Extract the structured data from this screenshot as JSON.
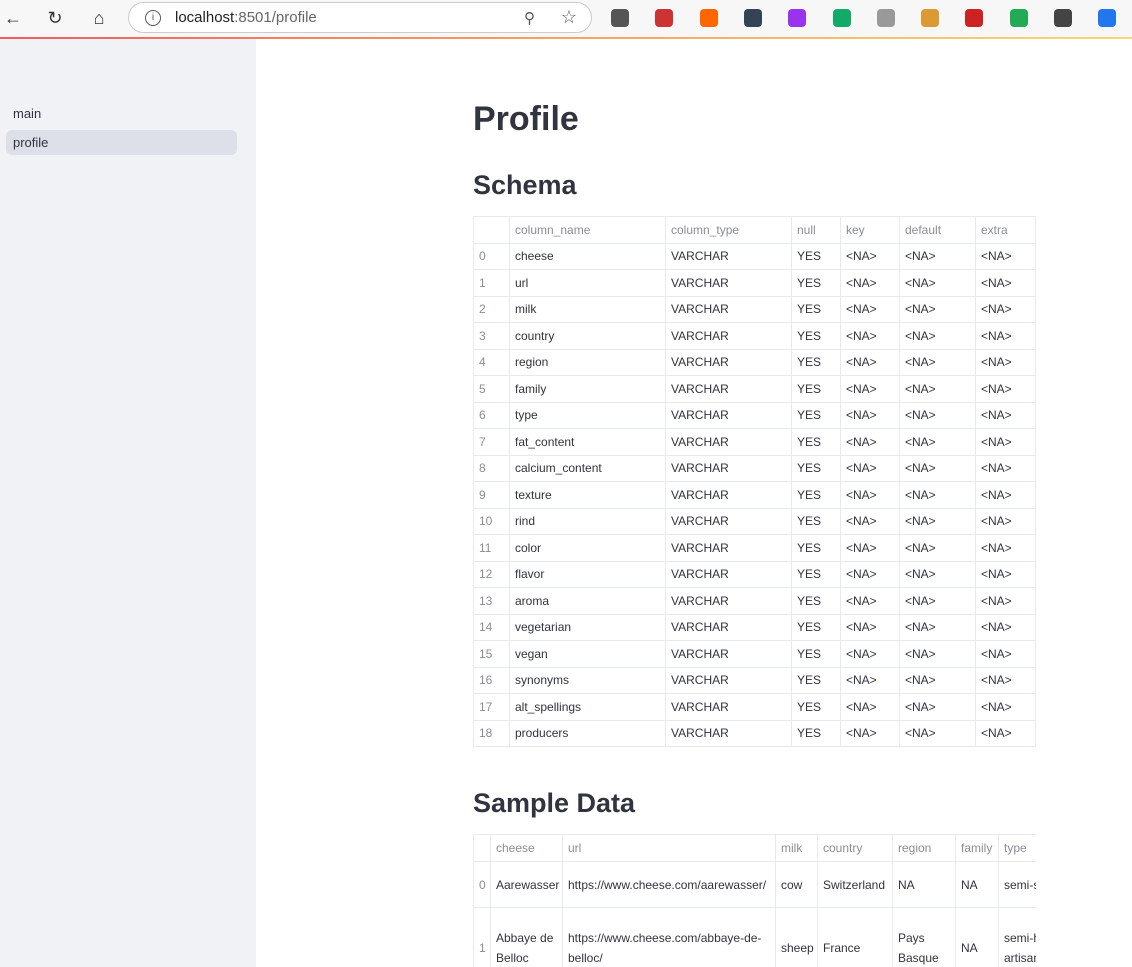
{
  "browser": {
    "url_host": "localhost",
    "url_rest": ":8501/profile",
    "extensions": [
      "#555",
      "#c33",
      "#f60",
      "#345",
      "#93e",
      "#1a6",
      "#999",
      "#d93",
      "#c22",
      "#2a5",
      "#444",
      "#27e"
    ]
  },
  "sidebar": {
    "items": [
      {
        "label": "main"
      },
      {
        "label": "profile",
        "active": true
      }
    ]
  },
  "page": {
    "title": "Profile",
    "schema_heading": "Schema",
    "sample_heading": "Sample Data"
  },
  "schema": {
    "headers": [
      "",
      "column_name",
      "column_type",
      "null",
      "key",
      "default",
      "extra"
    ],
    "rows": [
      [
        "0",
        "cheese"
      ],
      [
        "1",
        "url"
      ],
      [
        "2",
        "milk"
      ],
      [
        "3",
        "country"
      ],
      [
        "4",
        "region"
      ],
      [
        "5",
        "family"
      ],
      [
        "6",
        "type"
      ],
      [
        "7",
        "fat_content"
      ],
      [
        "8",
        "calcium_content"
      ],
      [
        "9",
        "texture"
      ],
      [
        "10",
        "rind"
      ],
      [
        "11",
        "color"
      ],
      [
        "12",
        "flavor"
      ],
      [
        "13",
        "aroma"
      ],
      [
        "14",
        "vegetarian"
      ],
      [
        "15",
        "vegan"
      ],
      [
        "16",
        "synonyms"
      ],
      [
        "17",
        "alt_spellings"
      ],
      [
        "18",
        "producers"
      ]
    ],
    "column_type": "VARCHAR",
    "null": "YES",
    "na": "<NA>"
  },
  "sample": {
    "headers": [
      "",
      "cheese",
      "url",
      "milk",
      "country",
      "region",
      "family",
      "type"
    ],
    "rows": [
      [
        "0",
        "Aarewasser",
        "https://www.cheese.com/aarewasser/",
        "cow",
        "Switzerland",
        "NA",
        "NA",
        "semi-soft"
      ],
      [
        "1",
        "Abbaye de Belloc",
        "https://www.cheese.com/abbaye-de-belloc/",
        "sheep",
        "France",
        "Pays Basque",
        "NA",
        "semi-hard, artisan"
      ]
    ]
  }
}
